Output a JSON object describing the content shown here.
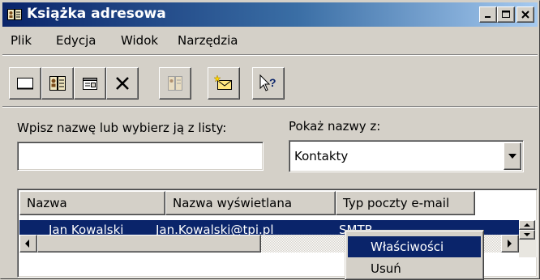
{
  "window": {
    "title": "Książka adresowa",
    "caption_buttons": [
      "minimize-icon",
      "maximize-icon",
      "close-icon"
    ]
  },
  "menubar": {
    "items": [
      {
        "label": "Plik"
      },
      {
        "label": "Edycja"
      },
      {
        "label": "Widok"
      },
      {
        "label": "Narzędzia"
      }
    ]
  },
  "toolbar": {
    "buttons": [
      {
        "icon": "new-contact-icon"
      },
      {
        "icon": "properties-card-icon"
      },
      {
        "icon": "properties-icon"
      },
      {
        "icon": "delete-icon"
      },
      {
        "icon": "address-book-icon"
      },
      {
        "icon": "new-message-icon"
      },
      {
        "icon": "whats-this-help-icon"
      }
    ]
  },
  "search": {
    "label": "Wpisz nazwę lub wybierz ją z listy:",
    "value": ""
  },
  "show_names": {
    "label": "Pokaż nazwy z:",
    "selected": "Kontakty"
  },
  "list": {
    "columns": [
      "Nazwa",
      "Nazwa wyświetlana",
      "Typ poczty e-mail"
    ],
    "rows": [
      {
        "name": "Jan Kowalski",
        "display_name": "Jan.Kowalski@tpi.pl",
        "mail_type": "SMTP",
        "selected": true
      }
    ]
  },
  "context_menu": {
    "items": [
      {
        "label": "Właściwości",
        "highlighted": true
      },
      {
        "label": "Usuń",
        "highlighted": false
      }
    ]
  },
  "colors": {
    "title_gradient_start": "#0a246a",
    "title_gradient_end": "#a6caf0",
    "selection": "#0a246a",
    "face": "#d4d0c8"
  }
}
